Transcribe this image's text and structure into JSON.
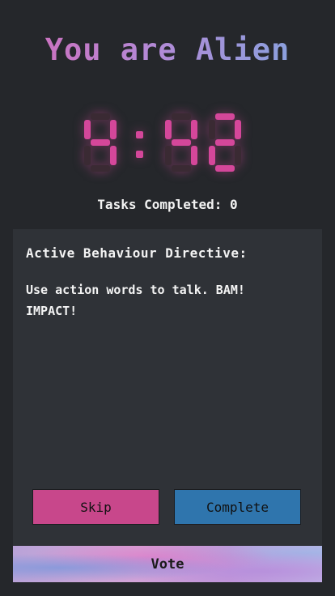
{
  "role": {
    "title": "You are Alien"
  },
  "timer": {
    "value": "4:42",
    "minutes": "4",
    "seconds": "42",
    "color": "#d4479a"
  },
  "tasks": {
    "text": "Tasks Completed: 0"
  },
  "directive": {
    "title": "Active Behaviour Directive:",
    "text": "Use action words to talk. BAM! IMPACT!"
  },
  "actions": {
    "skip_label": "Skip",
    "complete_label": "Complete",
    "vote_label": "Vote"
  },
  "colors": {
    "background": "#25272b",
    "card": "#2f3237",
    "skip": "#c8478b",
    "complete": "#2f75ad"
  }
}
